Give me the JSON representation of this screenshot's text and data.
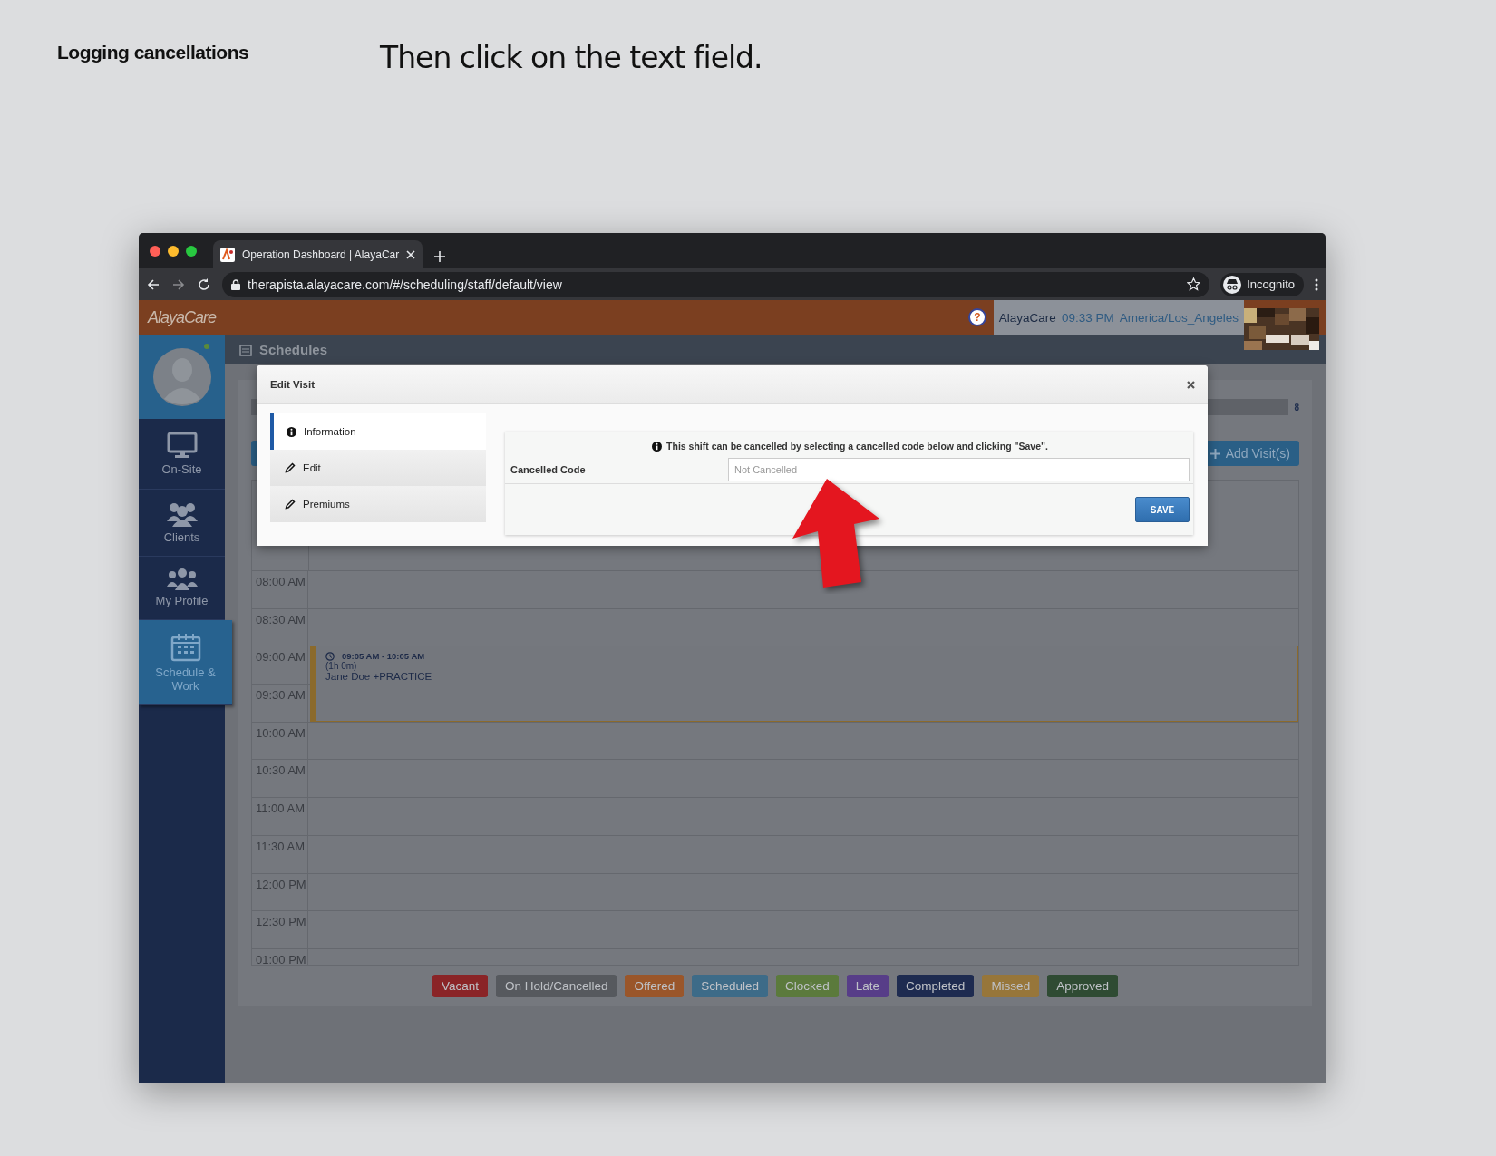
{
  "guide": {
    "section_title": "Logging cancellations",
    "instruction": "Then click on the text field."
  },
  "browser": {
    "tabs": [
      {
        "title": "Operation Dashboard | AlayaCar",
        "selected": true
      }
    ],
    "url": "therapista.alayacare.com/#/scheduling/staff/default/view",
    "profile": "Incognito"
  },
  "app": {
    "logo": "AlayaCare",
    "help": "?",
    "user": {
      "name": "AlayaCare",
      "time": "09:33 PM",
      "timezone": "America/Los_Angeles"
    },
    "sidebar": {
      "items": [
        {
          "label": "On-Site",
          "selected": false
        },
        {
          "label": "Clients",
          "selected": false
        },
        {
          "label": "My Profile",
          "selected": false
        },
        {
          "label": "Schedule & Work",
          "selected": true
        }
      ]
    },
    "page_title": "Schedules",
    "count": "8",
    "add_button": "Add Visit(s)",
    "calendar": {
      "times": [
        "08:00 AM",
        "08:30 AM",
        "09:00 AM",
        "09:30 AM",
        "10:00 AM",
        "10:30 AM",
        "11:00 AM",
        "11:30 AM",
        "12:00 PM",
        "12:30 PM",
        "01:00 PM"
      ],
      "events": [
        {
          "time": "09:05 AM - 10:05 AM",
          "duration": "(1h 0m)",
          "title": "Jane Doe +PRACTICE"
        }
      ]
    },
    "legend": [
      {
        "label": "Vacant",
        "color": "#8a2427"
      },
      {
        "label": "On Hold/Cancelled",
        "color": "#56595e"
      },
      {
        "label": "Offered",
        "color": "#9a562a"
      },
      {
        "label": "Scheduled",
        "color": "#3d6b88"
      },
      {
        "label": "Clocked",
        "color": "#5b7a3c"
      },
      {
        "label": "Late",
        "color": "#573d88"
      },
      {
        "label": "Completed",
        "color": "#1e2b50"
      },
      {
        "label": "Missed",
        "color": "#97763a"
      },
      {
        "label": "Approved",
        "color": "#2f4b33"
      }
    ]
  },
  "modal": {
    "title": "Edit Visit",
    "tabs": [
      {
        "label": "Information",
        "kind": "info",
        "selected": true
      },
      {
        "label": "Edit",
        "kind": "edit",
        "selected": false
      },
      {
        "label": "Premiums",
        "kind": "edit",
        "selected": false
      }
    ],
    "notice": "This shift can be cancelled by selecting a cancelled code below and clicking \"Save\".",
    "field": {
      "label": "Cancelled Code",
      "placeholder": "Not Cancelled"
    },
    "save": "SAVE"
  }
}
